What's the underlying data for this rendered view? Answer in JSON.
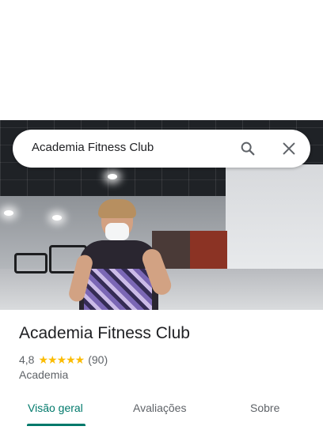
{
  "search": {
    "query": "Academia Fitness Club"
  },
  "place": {
    "name": "Academia Fitness Club",
    "rating": "4,8",
    "stars": "★★★★★",
    "review_count": "(90)",
    "category": "Academia"
  },
  "tabs": [
    {
      "label": "Visão geral",
      "active": true
    },
    {
      "label": "Avaliações",
      "active": false
    },
    {
      "label": "Sobre",
      "active": false
    }
  ],
  "icons": {
    "search": "search-icon",
    "close": "close-icon"
  },
  "colors": {
    "accent": "#00796b",
    "star": "#fbbc04",
    "text_secondary": "#5f6368"
  }
}
